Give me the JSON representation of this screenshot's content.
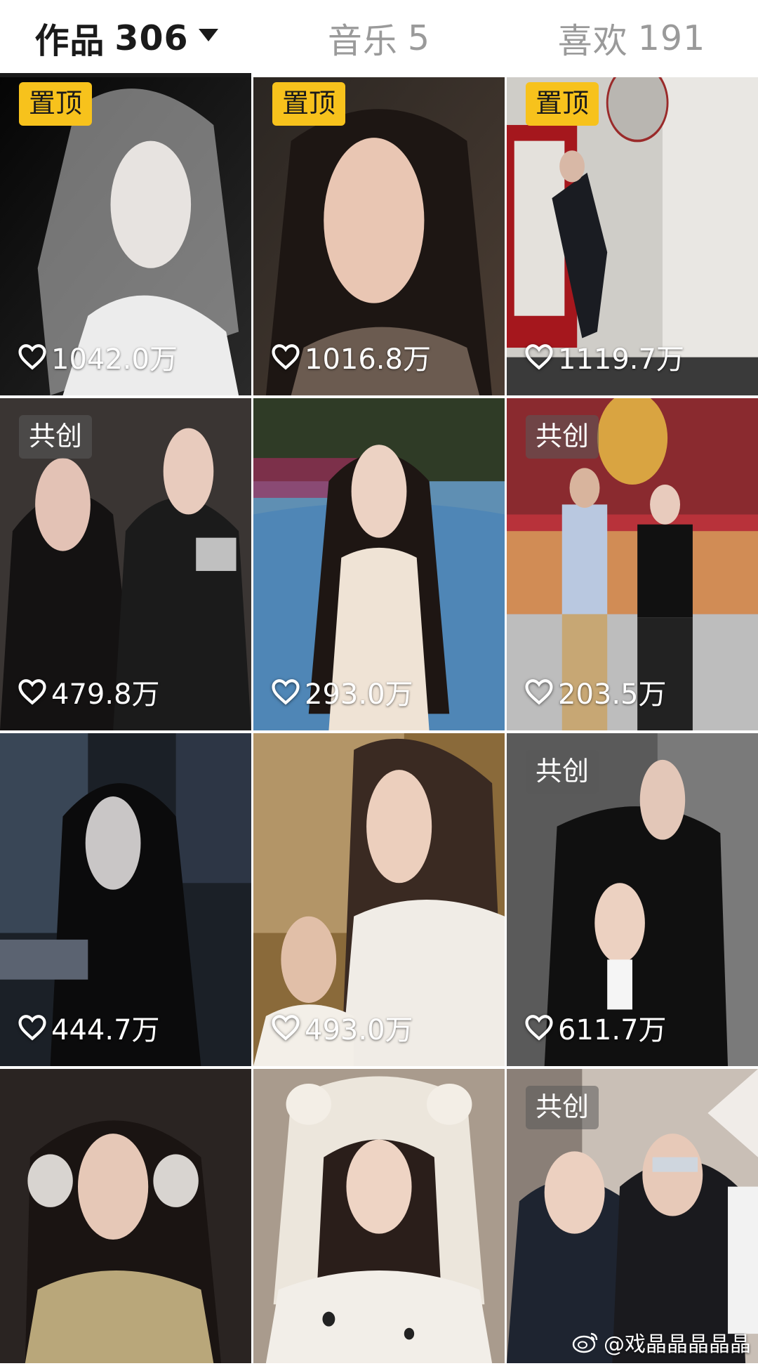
{
  "tabs": {
    "works": {
      "label": "作品",
      "count": "306"
    },
    "music": {
      "label": "音乐",
      "count": "5"
    },
    "likes": {
      "label": "喜欢",
      "count": "191"
    }
  },
  "badges": {
    "pinned": "置顶",
    "cocreate": "共创"
  },
  "videos": [
    {
      "likes": "1042.0万",
      "badge": "置顶"
    },
    {
      "likes": "1016.8万",
      "badge": "置顶"
    },
    {
      "likes": "1119.7万",
      "badge": "置顶"
    },
    {
      "likes": "479.8万",
      "badge": "共创"
    },
    {
      "likes": "293.0万",
      "badge": ""
    },
    {
      "likes": "203.5万",
      "badge": "共创"
    },
    {
      "likes": "444.7万",
      "badge": ""
    },
    {
      "likes": "493.0万",
      "badge": ""
    },
    {
      "likes": "611.7万",
      "badge": "共创"
    },
    {
      "likes": "",
      "badge": ""
    },
    {
      "likes": "",
      "badge": ""
    },
    {
      "likes": "",
      "badge": "共创"
    }
  ],
  "watermark": {
    "text": "@戏晶晶晶晶晶"
  }
}
